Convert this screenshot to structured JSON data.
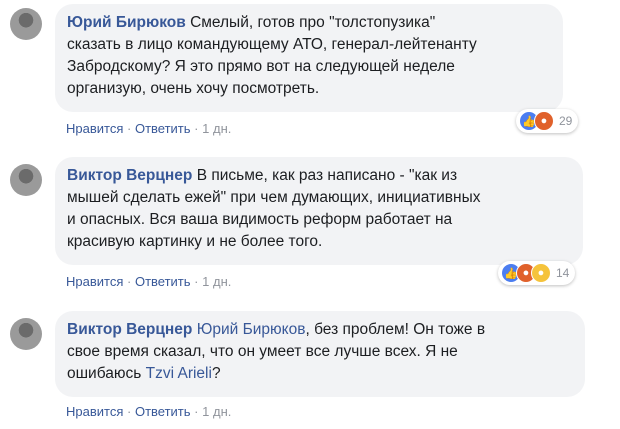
{
  "comments": [
    {
      "author": "Юрий Бирюков",
      "lines": [
        "Смелый, готов про \"толстопузика\"",
        "сказать в лицо командующему АТО, генерал-лейтенанту",
        "Забродскому? Я это прямо вот на следующей неделе",
        "организую, очень хочу посмотреть."
      ],
      "like_label": "Нравится",
      "reply_label": "Ответить",
      "time": "1 дн.",
      "reaction_count": "29",
      "reactions": [
        "like-icon",
        "angry-icon"
      ]
    },
    {
      "author": "Виктор Верцнер",
      "lines": [
        "В письме, как раз написано - \"как из",
        "мышей сделать ежей\" при чем думающих, инициативных",
        "и опасных. Вся ваша видимость реформ работает на",
        "красивую картинку и не более того."
      ],
      "like_label": "Нравится",
      "reply_label": "Ответить",
      "time": "1 дн.",
      "reaction_count": "14",
      "reactions": [
        "like-icon",
        "angry-icon",
        "sad-icon"
      ]
    },
    {
      "author": "Виктор Верцнер",
      "mention_1": "Юрий Бирюков",
      "line_1_rest": ", без проблем! Он тоже в",
      "line_2": "свое время сказал, что он умеет все лучше всех. Я не",
      "line_3_pre": "ошибаюсь ",
      "mention_2": "Tzvi Arieli",
      "line_3_post": "?",
      "like_label": "Нравится",
      "reply_label": "Ответить",
      "time": "1 дн."
    }
  ],
  "separator": "·"
}
